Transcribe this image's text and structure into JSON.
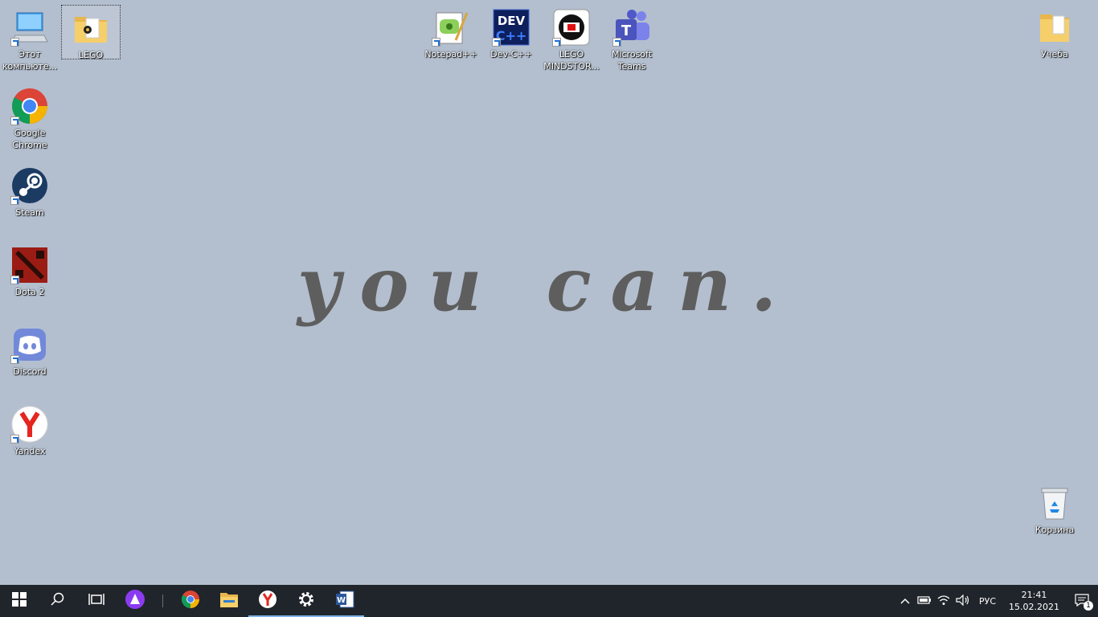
{
  "desktop": {
    "wallpaper_text": "you can.",
    "icons": {
      "this_pc": "Этот компьюте...",
      "lego_folder": "LEGO",
      "notepadpp": "Notepad++",
      "devcpp": "Dev-C++",
      "lego_mindstorms": "LEGO MINDSTOR...",
      "teams": "Microsoft Teams",
      "ucheba": "Учеба",
      "chrome": "Google Chrome",
      "steam": "Steam",
      "dota2": "Dota 2",
      "discord": "Discord",
      "yandex": "Yandex",
      "recycle_bin": "Корзина"
    }
  },
  "taskbar": {
    "pinned": [
      "start-icon",
      "search-icon",
      "task-view-icon",
      "alice-icon",
      "chrome-icon",
      "file-explorer-icon",
      "yandex-browser-icon",
      "settings-icon",
      "word-icon"
    ],
    "tray": {
      "language": "РУС",
      "time": "21:41",
      "date": "15.02.2021",
      "notification_count": "1"
    }
  },
  "colors": {
    "desktop_background": "#b3bfcf",
    "taskbar_background": "#20252b",
    "wallpaper_text": "#5e5e5e"
  }
}
